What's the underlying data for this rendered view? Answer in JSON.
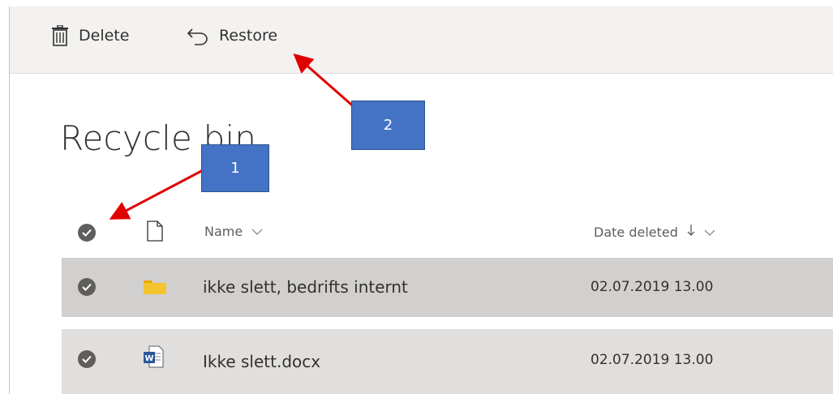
{
  "toolbar": {
    "delete_label": "Delete",
    "restore_label": "Restore"
  },
  "page": {
    "title": "Recycle bin"
  },
  "table": {
    "columns": {
      "name": "Name",
      "date_deleted": "Date deleted"
    },
    "rows": [
      {
        "name": "ikke slett, bedrifts internt",
        "date": "02.07.2019 13.00",
        "type": "folder-icon"
      },
      {
        "name": "Ikke slett.docx",
        "date": "02.07.2019 13.00",
        "type": "word-doc-icon"
      }
    ]
  },
  "annotations": {
    "callout1": "1",
    "callout2": "2"
  },
  "colors": {
    "toolbar_bg": "#f3f2f1",
    "selected_row": "#d2d0ce",
    "row": "#e1dfdd",
    "callout": "#4472c4",
    "arrow": "#e00000",
    "folder": "#f4c430",
    "word": "#2b579a"
  }
}
